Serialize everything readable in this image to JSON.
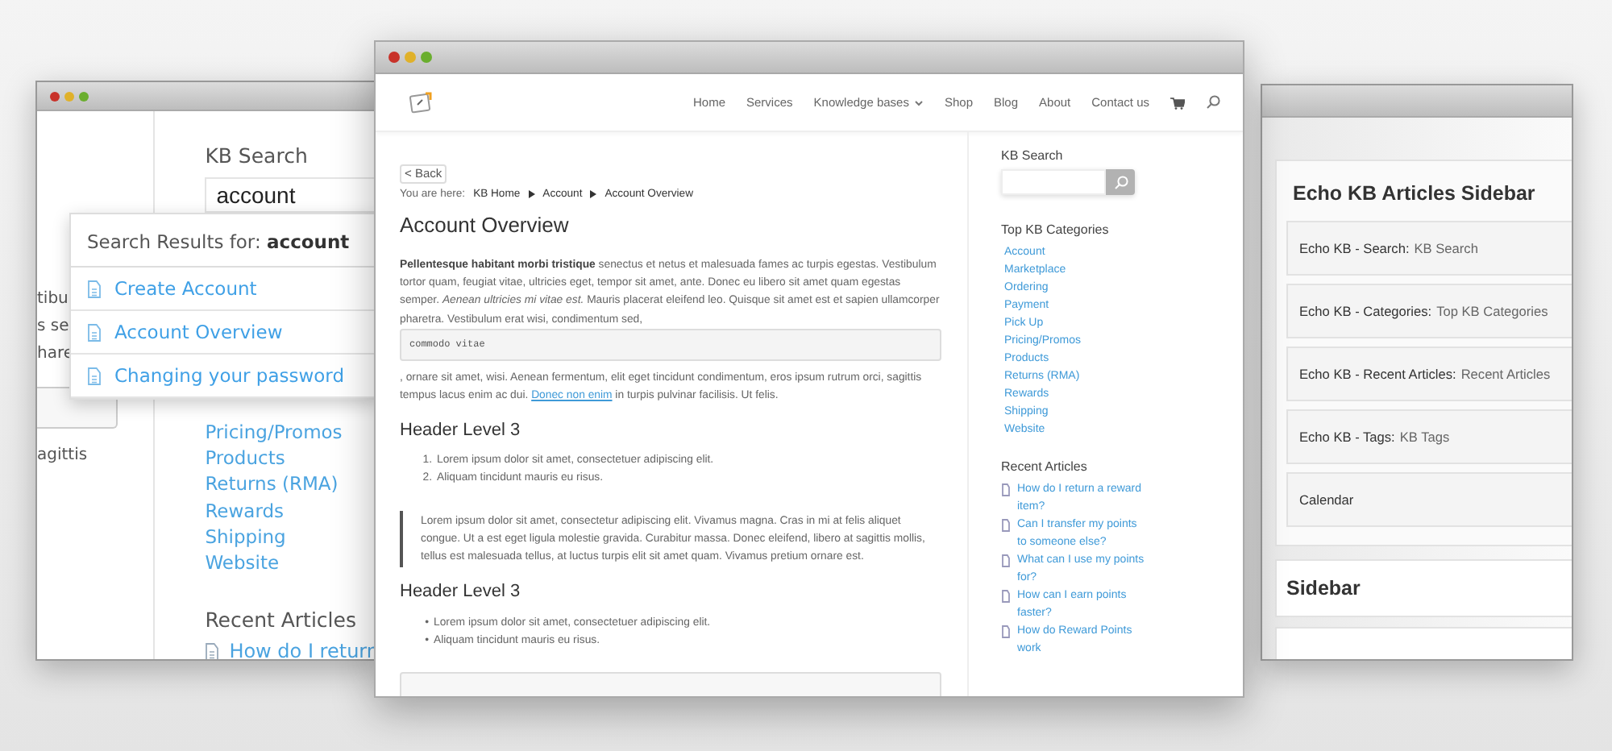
{
  "left_window": {
    "content_fragments": [
      "tibu",
      "s se",
      "hare"
    ],
    "trailing_fragment": "agittis",
    "search_title": "KB Search",
    "search_value": "account",
    "results_heading": "Search Results for: **account**",
    "results": [
      "Create Account",
      "Account Overview",
      "Changing your password"
    ],
    "categories": [
      "Pricing/Promos",
      "Products",
      "Returns (RMA)",
      "Rewards",
      "Shipping",
      "Website"
    ],
    "recent_title": "Recent Articles",
    "recent_articles": [
      "How do I return"
    ]
  },
  "main_window": {
    "nav": [
      {
        "label": "Home",
        "dropdown": false
      },
      {
        "label": "Services",
        "dropdown": false
      },
      {
        "label": "Knowledge bases",
        "dropdown": true
      },
      {
        "label": "Shop",
        "dropdown": false
      },
      {
        "label": "Blog",
        "dropdown": false
      },
      {
        "label": "About",
        "dropdown": false
      },
      {
        "label": "Contact us",
        "dropdown": false
      }
    ],
    "back_button": "< Back",
    "breadcrumb_label": "You are here:",
    "breadcrumb": [
      "KB Home",
      "Account",
      "Account Overview"
    ],
    "title": "Account Overview",
    "intro": "**Pellentesque habitant morbi tristique** senectus et netus et malesuada fames ac turpis egestas. Vestibulum tortor quam, feugiat vitae, ultricies eget, tempor sit amet, ante. Donec eu libero sit amet quam egestas semper. *Aenean ultricies mi vitae est.* Mauris placerat eleifend leo. Quisque sit amet est et sapien ullamcorper pharetra. Vestibulum erat wisi, condimentum sed,",
    "code": "commodo vitae",
    "after_code": ", ornare sit amet, wisi. Aenean fermentum, elit eget tincidunt condimentum, eros ipsum rutrum orci, sagittis tempus lacus enim ac dui.",
    "link": "Donec non enim",
    "after_link": "in turpis pulvinar facilisis. Ut felis.",
    "blocks": [
      {
        "kind": "heading",
        "text": "Header Level 3"
      },
      {
        "kind": "ordered_list",
        "items": [
          {
            "marker": "1.",
            "text": "Lorem ipsum dolor sit amet, consectetuer adipiscing elit."
          },
          {
            "marker": "2.",
            "text": "Aliquam tincidunt mauris eu risus."
          }
        ]
      },
      {
        "kind": "quote",
        "text": "Lorem ipsum dolor sit amet, consectetur adipiscing elit. Vivamus magna. Cras in mi at felis aliquet congue. Ut a est eget ligula molestie gravida. Curabitur massa. Donec eleifend, libero at sagittis mollis, tellus est malesuada tellus, at luctus turpis elit sit amet quam. Vivamus pretium ornare est."
      },
      {
        "kind": "heading",
        "text": "Header Level 3"
      },
      {
        "kind": "bullet_list",
        "items": [
          {
            "marker": "•",
            "text": "Lorem ipsum dolor sit amet, consectetuer adipiscing elit."
          },
          {
            "marker": "•",
            "text": "Aliquam tincidunt mauris eu risus."
          }
        ]
      },
      {
        "kind": "code_box"
      }
    ],
    "sidebar": {
      "search_title": "KB Search",
      "categories_title": "Top KB Categories",
      "categories": [
        "Account",
        "Marketplace",
        "Ordering",
        "Payment",
        "Pick Up",
        "Pricing/Promos",
        "Products",
        "Returns (RMA)",
        "Rewards",
        "Shipping",
        "Website"
      ],
      "recent_title": "Recent Articles",
      "recent_articles": [
        "How do I return a reward item?",
        "Can I transfer my points to someone else?",
        "What can I use my points for?",
        "How can I earn points faster?",
        "How do Reward Points work"
      ]
    }
  },
  "right_window": {
    "panel_title": "Echo KB Articles Sidebar",
    "widgets": [
      {
        "name": "Echo KB - Search:",
        "title": "KB Search"
      },
      {
        "name": "Echo KB - Categories:",
        "title": "Top KB Categories"
      },
      {
        "name": "Echo KB - Recent Articles:",
        "title": "Recent Articles"
      },
      {
        "name": "Echo KB - Tags:",
        "title": "KB Tags"
      },
      {
        "name": "Calendar"
      }
    ],
    "second_panel_title": "Sidebar"
  }
}
